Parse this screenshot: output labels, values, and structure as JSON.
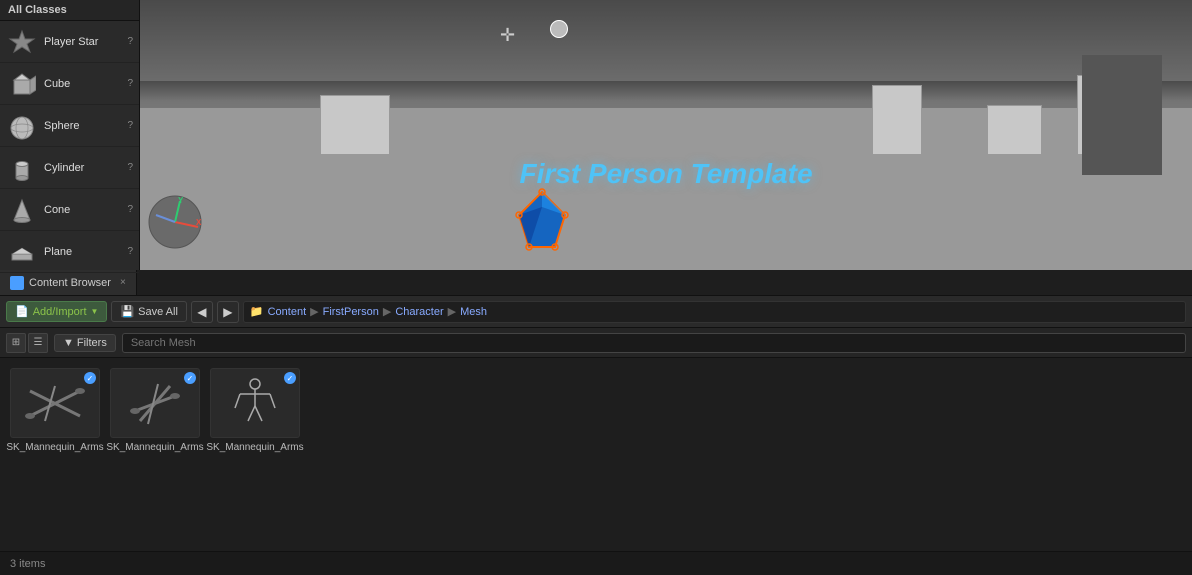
{
  "left_panel": {
    "header": "All Classes",
    "items": [
      {
        "name": "Player Star",
        "shape": "star"
      },
      {
        "name": "Cube",
        "shape": "cube"
      },
      {
        "name": "Sphere",
        "shape": "sphere"
      },
      {
        "name": "Cylinder",
        "shape": "cylinder"
      },
      {
        "name": "Cone",
        "shape": "cone"
      },
      {
        "name": "Plane",
        "shape": "plane"
      }
    ]
  },
  "viewport": {
    "scene_text": "First Person Template"
  },
  "content_browser": {
    "tab_label": "Content Browser",
    "tab_close": "×",
    "toolbar": {
      "add_import_label": "Add/Import",
      "save_all_label": "Save All",
      "nav_back": "◀",
      "nav_forward": "▶"
    },
    "breadcrumb": {
      "items": [
        "Content",
        "FirstPerson",
        "Character",
        "Mesh"
      ]
    },
    "filter": {
      "label": "Filters",
      "search_placeholder": "Search Mesh"
    },
    "assets": [
      {
        "name": "SK_Mannequin_Arms",
        "badge": "✓"
      },
      {
        "name": "SK_Mannequin_Arms",
        "badge": "✓"
      },
      {
        "name": "SK_Mannequin_Arms",
        "badge": "✓"
      }
    ],
    "status": "3 items"
  }
}
